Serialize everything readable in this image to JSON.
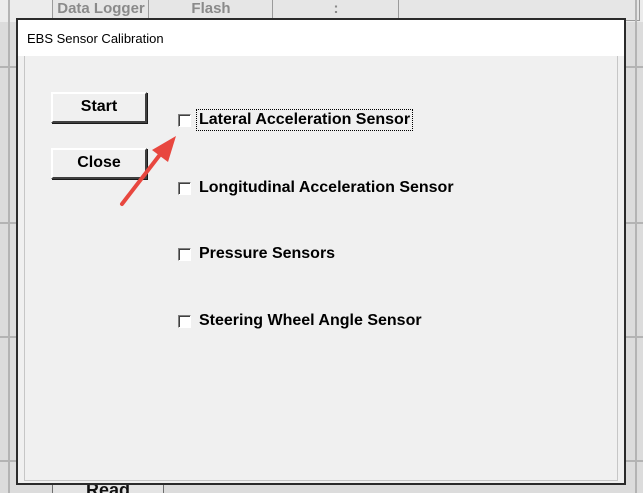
{
  "background": {
    "tabs": [
      {
        "label": "Data Logger"
      },
      {
        "label": "Flash"
      },
      {
        "label": ":"
      }
    ],
    "bottom_button": "Read"
  },
  "dialog": {
    "title": "EBS Sensor Calibration",
    "buttons": {
      "start": "Start",
      "close": "Close"
    },
    "sensors": [
      {
        "label": "Lateral Acceleration Sensor",
        "checked": false,
        "focused": true
      },
      {
        "label": "Longitudinal Acceleration Sensor",
        "checked": false,
        "focused": false
      },
      {
        "label": "Pressure Sensors",
        "checked": false,
        "focused": false
      },
      {
        "label": "Steering Wheel Angle Sensor",
        "checked": false,
        "focused": false
      }
    ]
  },
  "annotation": {
    "arrow_color": "#e8473f"
  }
}
